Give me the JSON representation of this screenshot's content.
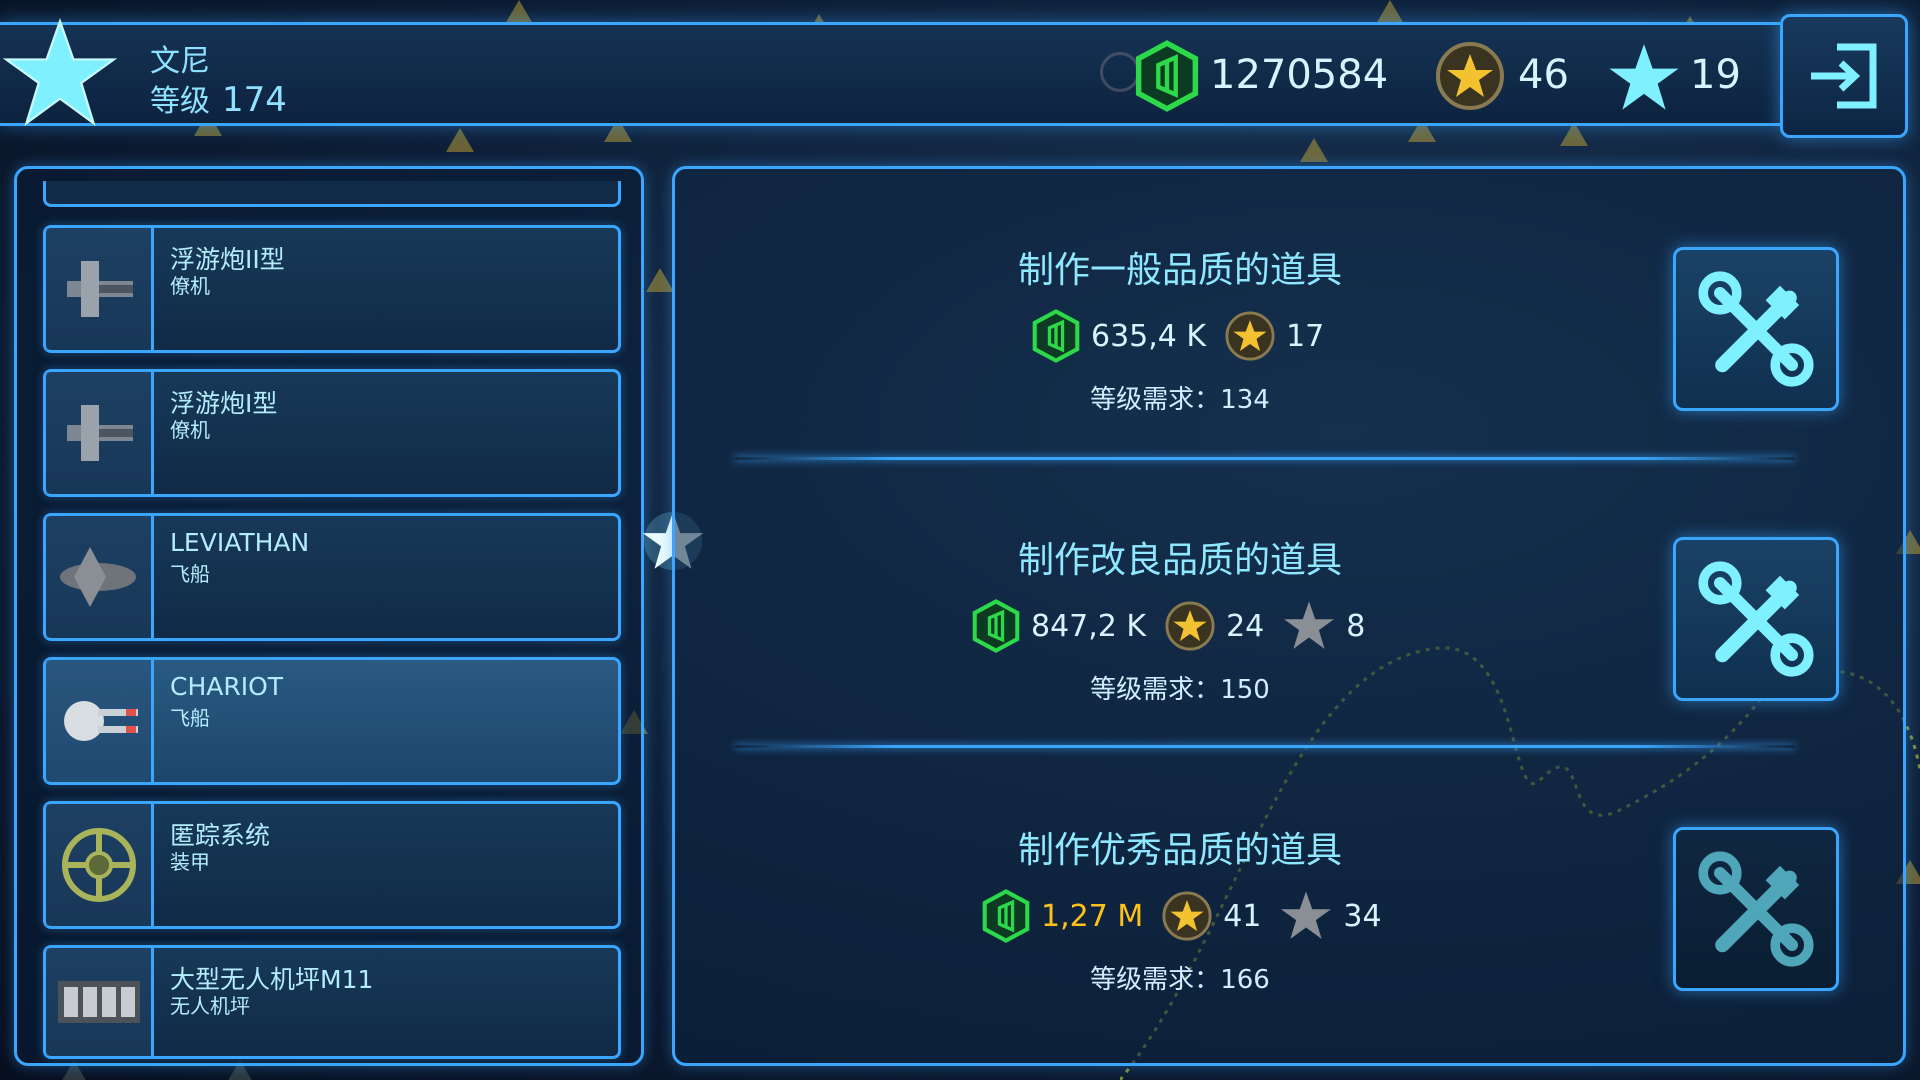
{
  "player": {
    "name": "文尼",
    "level_label": "等级",
    "level": "174"
  },
  "resources": {
    "credits": "1270584",
    "gold_stars": "46",
    "stars": "19"
  },
  "items": [
    {
      "name": "浮游炮II型",
      "type": "僚机",
      "icon": "drone-gun-icon",
      "selected": false
    },
    {
      "name": "浮游炮I型",
      "type": "僚机",
      "icon": "drone-gun-icon",
      "selected": false
    },
    {
      "name": "LEVIATHAN",
      "type": "飞船",
      "icon": "ship-icon",
      "selected": false
    },
    {
      "name": "CHARIOT",
      "type": "飞船",
      "icon": "ship-icon",
      "selected": true
    },
    {
      "name": "匿踪系统",
      "type": "装甲",
      "icon": "stealth-module-icon",
      "selected": false
    },
    {
      "name": "大型无人机坪M11",
      "type": "无人机坪",
      "icon": "drone-bay-icon",
      "selected": false
    }
  ],
  "crafting": [
    {
      "title": "制作一般品质的道具",
      "credits": "635,4 K",
      "credits_insufficient": false,
      "gold_stars": "17",
      "stars": null,
      "req_label": "等级需求：",
      "req_level": "134",
      "enabled": true
    },
    {
      "title": "制作改良品质的道具",
      "credits": "847,2 K",
      "credits_insufficient": false,
      "gold_stars": "24",
      "stars": "8",
      "req_label": "等级需求：",
      "req_level": "150",
      "enabled": true
    },
    {
      "title": "制作优秀品质的道具",
      "credits": "1,27 M",
      "credits_insufficient": true,
      "gold_stars": "41",
      "stars": "34",
      "req_label": "等级需求：",
      "req_level": "166",
      "enabled": false
    }
  ],
  "colors": {
    "accent": "#3aa6ff",
    "credit_green": "#2bd94a",
    "gold": "#f2c230",
    "insufficient": "#ffc21a",
    "title_cyan": "#8fe8ff"
  }
}
